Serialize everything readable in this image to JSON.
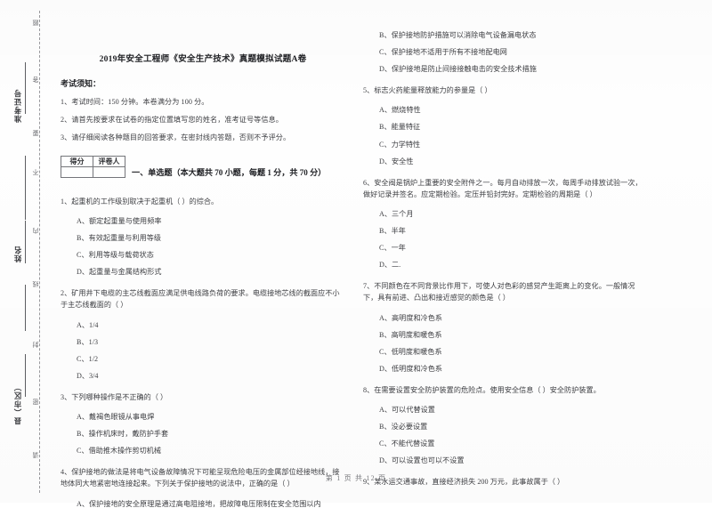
{
  "page": {
    "title": "2019年安全工程师《安全生产技术》真题模拟试题A卷",
    "footer": "第 1 页 共 12 页"
  },
  "seal_margin": {
    "labels": [
      {
        "name": "admission-number",
        "text": "准考证号"
      },
      {
        "name": "student-name",
        "text": "姓名"
      },
      {
        "name": "county-district",
        "text": "县（市区）"
      }
    ],
    "ticks": [
      "题",
      "答",
      "要",
      "不",
      "内",
      "线",
      "封",
      "密",
      "请"
    ]
  },
  "notice": {
    "heading": "考试须知：",
    "items": [
      "1、考试时间：150 分钟。本卷满分为 100 分。",
      "2、请首先按要求在试卷的指定位置填写您的姓名，准考证号等信息。",
      "3、请仔细阅读各种题目的回答要求，在密封线内答题，否则不予评分。"
    ]
  },
  "score_box": {
    "headers": [
      "得分",
      "评卷人"
    ],
    "values": [
      "",
      ""
    ]
  },
  "section": {
    "title": "一、单选题（本大题共 70 小题，每题 1 分，共 70 分）"
  },
  "questions": [
    {
      "number": "1、",
      "stem": "1、起重机的工作级别取决于起重机（        ）的综合。",
      "options": [
        "A、额定起重量与使用频率",
        "B、有效起重量与利用等级",
        "C、利用等级与载荷状态",
        "D、起重量与金属结构形式"
      ]
    },
    {
      "number": "2、",
      "stem": "2、矿用井下电缆的主芯线截面应满足供电线路负荷的要求。电缆接地芯线的截面应不小于主芯线截面的（        ）",
      "options": [
        "A、1/4",
        "B、1/3",
        "C、1/2",
        "D、3/4"
      ]
    },
    {
      "number": "3、",
      "stem": "3、下列哪种操作是不正确的（        ）",
      "options": [
        "A、戴褐色眼镜从事电焊",
        "B、操作机床时，戴防护手套",
        "C、借助推木操作剪切机械"
      ]
    },
    {
      "number": "4、",
      "stem": "4、保护接地的做法是将电气设备故障情况下可能呈现危险电压的金属部位经接地线，接地体同大地紧密地连接起来。下列关于保护接地的说法中，正确的是（        ）",
      "options": [
        "A、保护接地的安全原理是通过高电阻接地，把故障电压限制在安全范围以内",
        "B、保护接地防护措施可以消除电气设备漏电状态",
        "C、保护接地不适用于所有不接地配电网",
        "D、保护接地是防止间接接触电击的安全技术措施"
      ]
    },
    {
      "number": "5、",
      "stem": "5、标志火药能量释放能力的参量是（        ）",
      "options": [
        "A、燃烧特性",
        "B、能量特征",
        "C、力学特性",
        "D、安全性"
      ]
    },
    {
      "number": "6、",
      "stem": "6、安全阀是锅炉上重要的安全附件之一。每月自动排放一次，每周手动排放试验一次，做好记录并签名。应定期检验。定压并铅封完好。定期检验的周期是（        ）",
      "options": [
        "A、三个月",
        "B、半年",
        "C、一年",
        "D、二."
      ]
    },
    {
      "number": "7、",
      "stem": "7、不同颜色在不同背景比作用下，可使人对色彩的感觉产生距离上的变化。一般情况下，具有前进、凸出和接近感觉的颜色是（        ）",
      "options": [
        "A、高明度和冷色系",
        "B、高明度和暖色系",
        "C、低明度和暖色系",
        "D、低明度和冷色系"
      ]
    },
    {
      "number": "8、",
      "stem": "8、在需要设置安全防护装置的危险点。使用安全信息（        ）安全防护装置。",
      "options": [
        "A、可以代替设置",
        "B、没必要设置",
        "C、不能代替设置",
        "D、可以设置也可以不设置"
      ]
    },
    {
      "number": "9、",
      "stem": "9、某水运交通事故，直接经济损失 200 万元，此事故属于（        ）",
      "options": []
    }
  ],
  "columns": {
    "left": {
      "questions": [
        0,
        1,
        2,
        3
      ],
      "q4_options_shown": 1
    },
    "right": {
      "q4_options_remaining": [
        1,
        2,
        3
      ],
      "questions": [
        4,
        5,
        6,
        7,
        8
      ]
    }
  }
}
